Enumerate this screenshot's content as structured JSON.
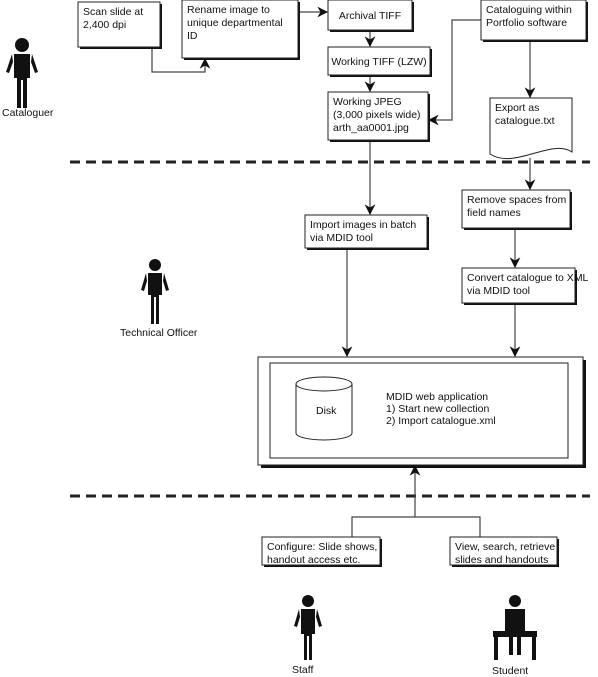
{
  "actors": {
    "cataloguer": "Cataloguer",
    "technical_officer": "Technical Officer",
    "staff": "Staff",
    "student": "Student"
  },
  "steps": {
    "scan": [
      "Scan slide at",
      "2,400 dpi"
    ],
    "rename": [
      "Rename image to",
      "unique departmental",
      "ID"
    ],
    "archival": [
      "Archival TIFF"
    ],
    "working_tiff": [
      "Working TIFF (LZW)"
    ],
    "working_jpeg": [
      "Working JPEG",
      "(3,000 pixels wide)",
      "arth_aa0001.jpg"
    ],
    "cataloguing": [
      "Cataloguing within",
      "Portfolio software"
    ],
    "export": [
      "Export as",
      "catalogue.txt"
    ],
    "remove_spaces": [
      "Remove spaces from",
      "field names"
    ],
    "import_images": [
      "Import images in batch",
      "via MDID tool"
    ],
    "convert": [
      "Convert catalogue to XML",
      "via MDID tool"
    ],
    "configure": [
      "Configure: Slide shows,",
      "handout access etc."
    ],
    "view": [
      "View, search, retrieve",
      "slides and handouts"
    ]
  },
  "mdid": {
    "disk": "Disk",
    "title": "MDID web application",
    "items": [
      "1)  Start new collection",
      "2)  Import catalogue.xml"
    ]
  }
}
